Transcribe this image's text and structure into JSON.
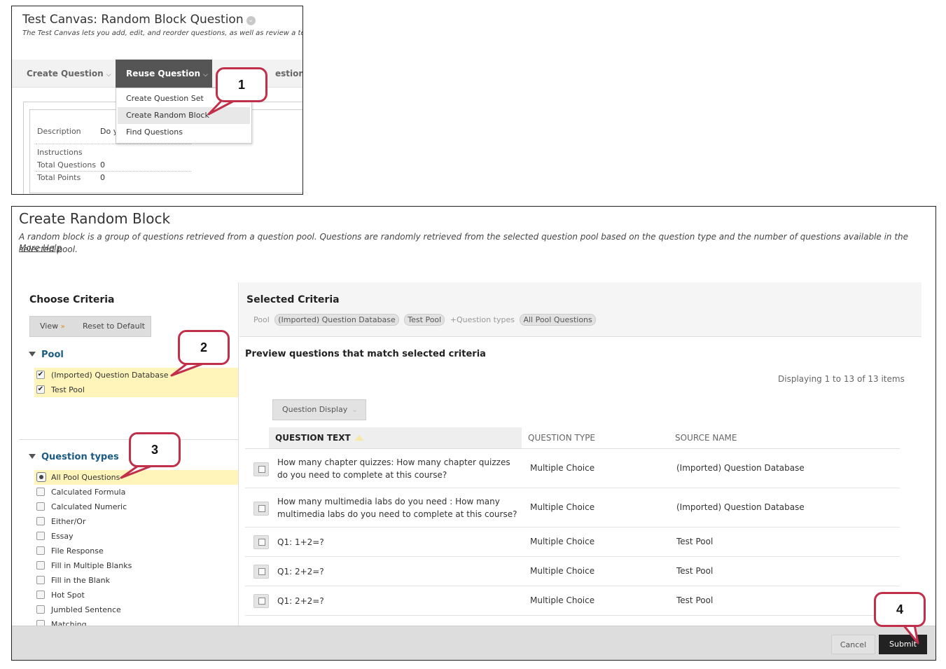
{
  "test_canvas": {
    "title": "Test Canvas: Random Block Question",
    "description": "The Test Canvas lets you add, edit, and reorder questions, as well as review a te",
    "toolbar": {
      "create_question": "Create Question",
      "reuse_question": "Reuse Question",
      "more": "estions"
    },
    "reuse_menu": [
      "Create Question Set",
      "Create Random Block",
      "Find Questions"
    ],
    "info": {
      "description_label": "Description",
      "description_value": "Do y",
      "instructions_label": "Instructions",
      "total_questions_label": "Total Questions",
      "total_questions_value": "0",
      "total_points_label": "Total Points",
      "total_points_value": "0"
    }
  },
  "random_block": {
    "title": "Create Random Block",
    "description": "A random block is a group of questions retrieved from a question pool. Questions are randomly retrieved from the selected question pool based on the question type and the number of questions available in the selected pool.",
    "more_help": "More Help",
    "choose_criteria": {
      "title": "Choose Criteria",
      "view_label": "View",
      "reset_label": "Reset to Default",
      "pool_heading": "Pool",
      "pools": [
        {
          "label": "(Imported) Question Database",
          "checked": true
        },
        {
          "label": "Test Pool",
          "checked": true
        }
      ],
      "question_types_heading": "Question types",
      "question_types": [
        {
          "label": "All Pool Questions",
          "selected": true
        },
        {
          "label": "Calculated Formula"
        },
        {
          "label": "Calculated Numeric"
        },
        {
          "label": "Either/Or"
        },
        {
          "label": "Essay"
        },
        {
          "label": "File Response"
        },
        {
          "label": "Fill in Multiple Blanks"
        },
        {
          "label": "Fill in the Blank"
        },
        {
          "label": "Hot Spot"
        },
        {
          "label": "Jumbled Sentence"
        },
        {
          "label": "Matching"
        }
      ]
    },
    "selected_criteria": {
      "title": "Selected Criteria",
      "pool_label": "Pool",
      "pools": [
        "(Imported) Question Database",
        "Test Pool"
      ],
      "question_types_label": "Question types",
      "question_types": [
        "All Pool Questions"
      ]
    },
    "preview": {
      "title": "Preview questions that match selected criteria",
      "displaying": "Displaying 1 to 13 of 13 items",
      "question_display": "Question Display",
      "columns": [
        "QUESTION TEXT",
        "QUESTION TYPE",
        "SOURCE NAME"
      ],
      "rows": [
        {
          "text": "How many chapter quizzes: How many chapter quizzes do you need to complete at this course?",
          "type": "Multiple Choice",
          "source": "(Imported) Question Database"
        },
        {
          "text": "How many multimedia labs do you need : How many multimedia labs do you need to complete at this course?",
          "type": "Multiple Choice",
          "source": "(Imported) Question Database"
        },
        {
          "text": "Q1: 1+2=?",
          "type": "Multiple Choice",
          "source": "Test Pool"
        },
        {
          "text": "Q1: 2+2=?",
          "type": "Multiple Choice",
          "source": "Test Pool"
        },
        {
          "text": "Q1: 2+2=?",
          "type": "Multiple Choice",
          "source": "Test Pool"
        }
      ]
    },
    "footer": {
      "cancel": "Cancel",
      "submit": "Submit"
    }
  },
  "callouts": [
    "1",
    "2",
    "3",
    "4"
  ],
  "colors": {
    "callout_border": "#c0304a",
    "selection_highlight": "#fff5bb",
    "section_heading": "#1b5a83",
    "submit_bg": "#222222"
  }
}
